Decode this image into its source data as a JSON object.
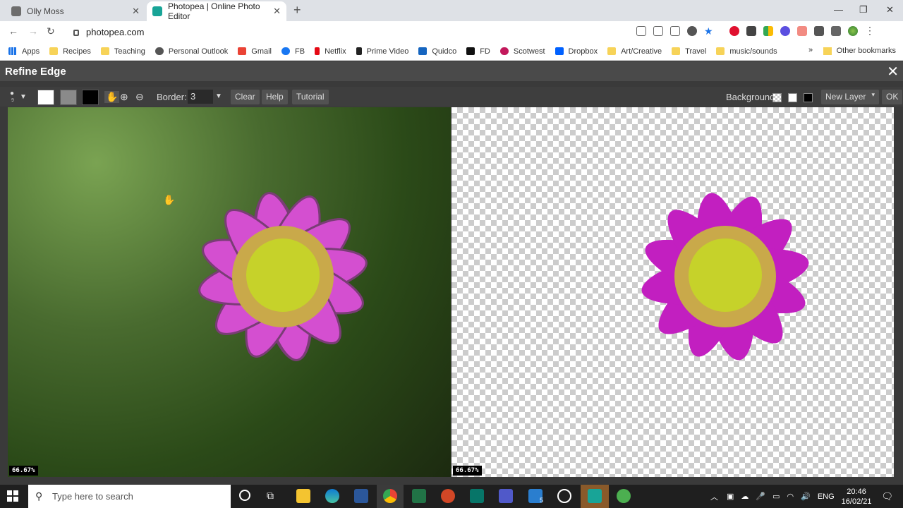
{
  "browser": {
    "tabs": [
      {
        "label": "Olly Moss",
        "favicon_color": "#6d6d6d"
      },
      {
        "label": "Photopea | Online Photo Editor",
        "favicon_color": "#18a497"
      }
    ],
    "url": "photopea.com",
    "bookmarks": [
      {
        "label": "Apps",
        "icon": "apps-grid-icon"
      },
      {
        "label": "Recipes",
        "icon": "folder-icon"
      },
      {
        "label": "Teaching",
        "icon": "folder-icon"
      },
      {
        "label": "Personal Outlook",
        "icon": "globe-icon"
      },
      {
        "label": "Gmail",
        "icon": "gmail-icon"
      },
      {
        "label": "FB",
        "icon": "facebook-icon"
      },
      {
        "label": "Netflix",
        "icon": "netflix-icon"
      },
      {
        "label": "Prime Video",
        "icon": "amazon-icon"
      },
      {
        "label": "Quidco",
        "icon": "quidco-icon"
      },
      {
        "label": "FD",
        "icon": "fd-icon"
      },
      {
        "label": "Scotwest",
        "icon": "scotwest-icon"
      },
      {
        "label": "Dropbox",
        "icon": "dropbox-icon"
      },
      {
        "label": "Art/Creative",
        "icon": "folder-icon"
      },
      {
        "label": "Travel",
        "icon": "folder-icon"
      },
      {
        "label": "music/sounds",
        "icon": "folder-icon"
      }
    ],
    "overflow": "»",
    "other_bookmarks": "Other bookmarks"
  },
  "dialog": {
    "title": "Refine Edge",
    "brush_size": "9",
    "border_label": "Border:",
    "border_value": "3",
    "buttons": {
      "clear": "Clear",
      "help": "Help",
      "tutorial": "Tutorial"
    },
    "background_label": "Background:",
    "output": "New Layer",
    "ok": "OK",
    "zoom_left": "66.67%",
    "zoom_right": "66.67%"
  },
  "taskbar": {
    "search_placeholder": "Type here to search",
    "lang": "ENG",
    "time": "20:46",
    "date": "16/02/21",
    "mail_badge": "5"
  },
  "colors": {
    "petal": "#d44fd0",
    "petal_cut": "#c21fc0",
    "center": "#c6d22a",
    "accent": "#18a497"
  }
}
